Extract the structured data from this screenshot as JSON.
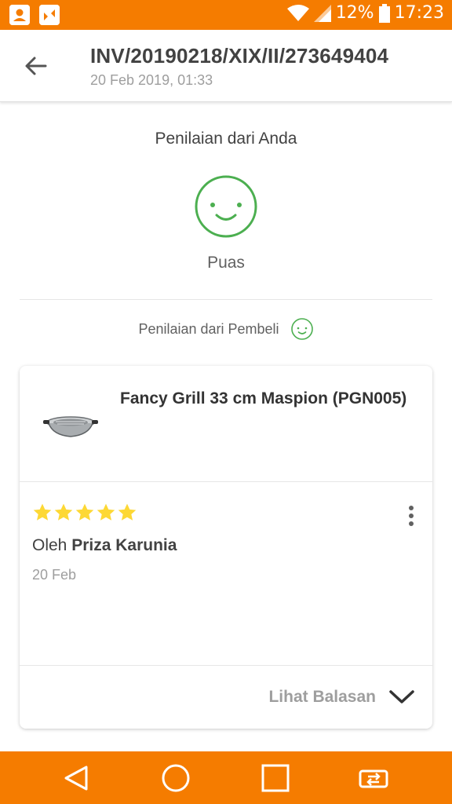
{
  "status_bar": {
    "battery_percent": "12%",
    "time": "17:23"
  },
  "header": {
    "invoice_number": "INV/20190218/XIX/II/273649404",
    "invoice_date": "20 Feb 2019, 01:33"
  },
  "your_rating": {
    "title": "Penilaian dari Anda",
    "label": "Puas",
    "icon": "smiley-icon"
  },
  "buyer_rating": {
    "label": "Penilaian dari Pembeli",
    "icon": "smiley-icon"
  },
  "product": {
    "name": "Fancy Grill 33 cm Maspion (PGN005)"
  },
  "review": {
    "stars": 5,
    "stars_max": 5,
    "by_prefix": "Oleh",
    "reviewer": "Priza Karunia",
    "date": "20 Feb"
  },
  "replies": {
    "label": "Lihat Balasan"
  },
  "colors": {
    "accent": "#f57c00",
    "smiley_green": "#4caf50",
    "star_yellow": "#fdd835"
  }
}
